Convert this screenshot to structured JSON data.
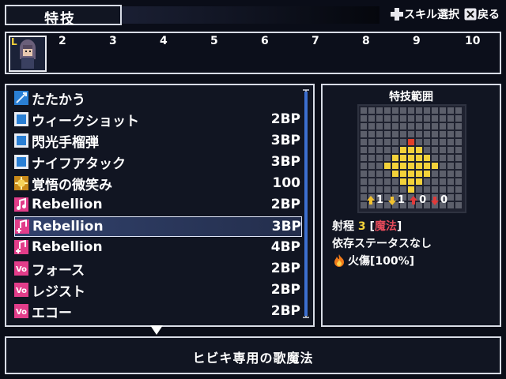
{
  "screen": {
    "title": "特技",
    "hints": [
      {
        "icon": "dpad-icon",
        "label": "スキル選択"
      },
      {
        "icon": "x-button-icon",
        "label": "戻る"
      }
    ]
  },
  "turn_order": {
    "leader_mark": "L",
    "numbers": [
      "2",
      "3",
      "4",
      "5",
      "6",
      "7",
      "8",
      "9",
      "10"
    ]
  },
  "skills": [
    {
      "icon": "sword-icon",
      "name": "たたかう",
      "cost": ""
    },
    {
      "icon": "skill-square-icon",
      "name": "ウィークショット",
      "cost": "2BP"
    },
    {
      "icon": "skill-square-icon",
      "name": "閃光手榴弾",
      "cost": "3BP"
    },
    {
      "icon": "skill-square-icon",
      "name": "ナイフアタック",
      "cost": "3BP"
    },
    {
      "icon": "gold-burst-icon",
      "name": "覚悟の微笑み",
      "cost": "100"
    },
    {
      "icon": "music-note-icon",
      "name": "Rebellion",
      "cost": "2BP"
    },
    {
      "icon": "music-plus-icon",
      "name": "Rebellion",
      "cost": "3BP",
      "selected": true
    },
    {
      "icon": "music-plus-icon",
      "name": "Rebellion",
      "cost": "4BP"
    },
    {
      "icon": "vo-icon",
      "name": "フォース",
      "cost": "2BP"
    },
    {
      "icon": "vo-icon",
      "name": "レジスト",
      "cost": "2BP"
    },
    {
      "icon": "vo-icon",
      "name": "エコー",
      "cost": "2BP"
    }
  ],
  "range_panel": {
    "header": "特技範囲",
    "stats": [
      {
        "icon": "arrow-up-icon",
        "color": "#f2c230",
        "value": "1"
      },
      {
        "icon": "arrow-down-icon",
        "color": "#f2c230",
        "value": "1"
      },
      {
        "icon": "arrow-up-icon",
        "color": "#e03a3a",
        "value": "0"
      },
      {
        "icon": "arrow-down-icon",
        "color": "#e03a3a",
        "value": "0"
      }
    ],
    "range_label": "射程",
    "range_value": "3",
    "range_type_open": "[",
    "range_type": "魔法",
    "range_type_close": "]",
    "dependency": "依存ステータスなし",
    "element_icon": "fire-icon",
    "element": "火傷[100%]"
  },
  "description": "ヒビキ専用の歌魔法",
  "colors": {
    "panel_bg": "#111522",
    "border": "#d8dce6",
    "accent_yellow": "#f3d23a",
    "magic_red": "#e34a5a",
    "highlight": "#5a78c8"
  }
}
